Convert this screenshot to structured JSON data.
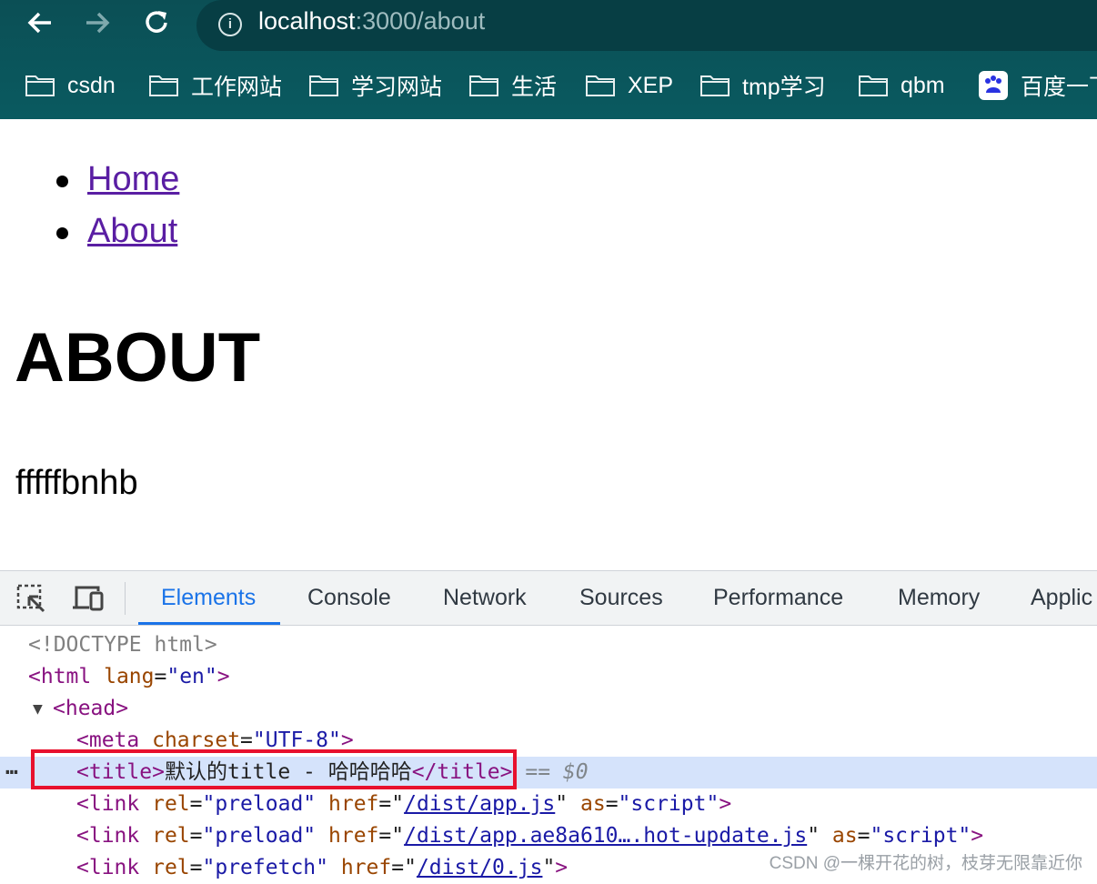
{
  "browser": {
    "url_host": "localhost",
    "url_rest": ":3000/about",
    "bookmarks": [
      "csdn",
      "工作网站",
      "学习网站",
      "生活",
      "XEP",
      "tmp学习",
      "qbm",
      "百度一下"
    ]
  },
  "page": {
    "nav": [
      "Home",
      "About"
    ],
    "heading": "ABOUT",
    "paragraph": "fffffbnhb"
  },
  "devtools": {
    "tabs": [
      "Elements",
      "Console",
      "Network",
      "Sources",
      "Performance",
      "Memory",
      "Applic"
    ],
    "active_tab": "Elements",
    "lines": {
      "doctype": "<!DOCTYPE html>",
      "html_tag_open": "<html",
      "html_attr": "lang",
      "html_val": "\"en\"",
      "head": "<head>",
      "meta_open": "<meta",
      "meta_attr": "charset",
      "meta_val": "\"UTF-8\"",
      "title_open": "<title>",
      "title_text": "默认的title - 哈哈哈哈",
      "title_close": "</title>",
      "selected_suffix": "== $0",
      "link1_href": "/dist/app.js",
      "link1_as": "\"script\"",
      "link2_href": "/dist/app.ae8a610….hot-update.js",
      "link2_as": "\"script\"",
      "link3_href": "/dist/0.js",
      "rel_preload": "\"preload\"",
      "rel_prefetch": "\"prefetch\""
    }
  },
  "watermark": "CSDN @一棵开花的树，枝芽无限靠近你"
}
